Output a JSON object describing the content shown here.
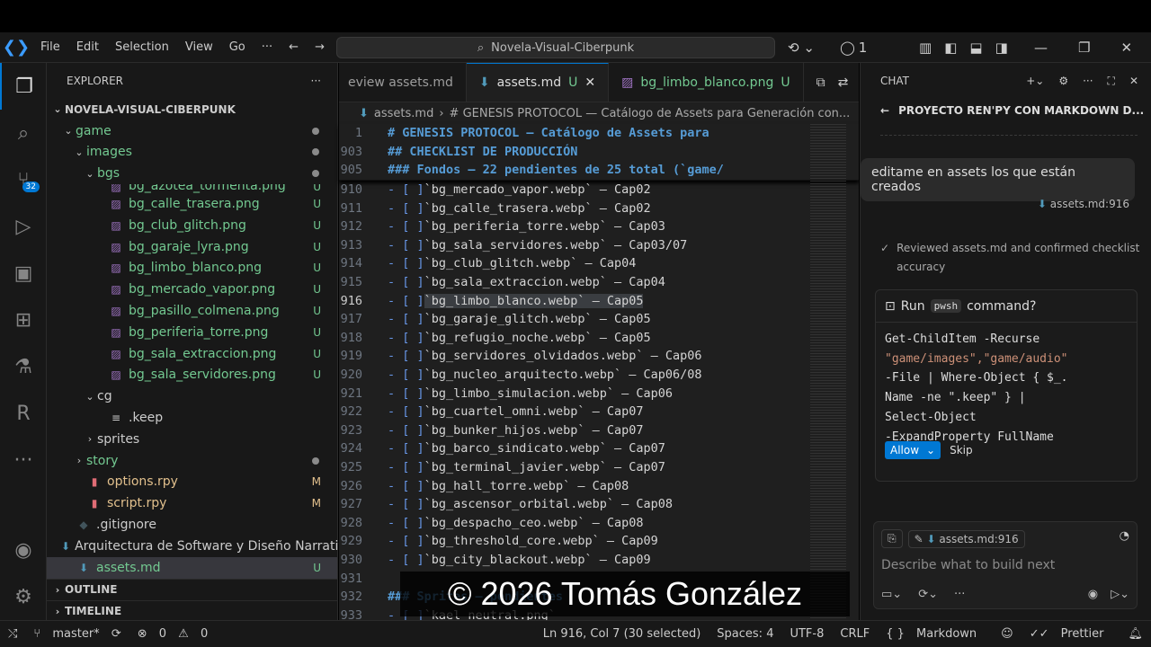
{
  "menu": [
    "File",
    "Edit",
    "Selection",
    "View",
    "Go"
  ],
  "command_center": "Novela-Visual-Ciberpunk",
  "titlebar_counter": "1",
  "source_control_badge": "32",
  "explorer": {
    "title": "EXPLORER",
    "root": "NOVELA-VISUAL-CIBERPUNK",
    "items": [
      {
        "label": "game",
        "depth": 1,
        "kind": "folder-open",
        "status": "dot"
      },
      {
        "label": "images",
        "depth": 2,
        "kind": "folder-open",
        "status": "dot"
      },
      {
        "label": "bgs",
        "depth": 3,
        "kind": "folder-open",
        "status": "dot"
      },
      {
        "label": "bg_azotea_tormenta.png",
        "depth": 4,
        "kind": "png",
        "status": "U",
        "partial": true
      },
      {
        "label": "bg_calle_trasera.png",
        "depth": 4,
        "kind": "png",
        "status": "U"
      },
      {
        "label": "bg_club_glitch.png",
        "depth": 4,
        "kind": "png",
        "status": "U"
      },
      {
        "label": "bg_garaje_lyra.png",
        "depth": 4,
        "kind": "png",
        "status": "U"
      },
      {
        "label": "bg_limbo_blanco.png",
        "depth": 4,
        "kind": "png",
        "status": "U"
      },
      {
        "label": "bg_mercado_vapor.png",
        "depth": 4,
        "kind": "png",
        "status": "U"
      },
      {
        "label": "bg_pasillo_colmena.png",
        "depth": 4,
        "kind": "png",
        "status": "U"
      },
      {
        "label": "bg_periferia_torre.png",
        "depth": 4,
        "kind": "png",
        "status": "U"
      },
      {
        "label": "bg_sala_extraccion.png",
        "depth": 4,
        "kind": "png",
        "status": "U"
      },
      {
        "label": "bg_sala_servidores.png",
        "depth": 4,
        "kind": "png",
        "status": "U"
      },
      {
        "label": "cg",
        "depth": 3,
        "kind": "folder-open",
        "status": ""
      },
      {
        "label": ".keep",
        "depth": 4,
        "kind": "file",
        "status": ""
      },
      {
        "label": "sprites",
        "depth": 3,
        "kind": "folder",
        "status": ""
      },
      {
        "label": "story",
        "depth": 2,
        "kind": "folder",
        "status": "dot"
      },
      {
        "label": "options.rpy",
        "depth": 2,
        "kind": "rpy",
        "status": "M"
      },
      {
        "label": "script.rpy",
        "depth": 2,
        "kind": "rpy",
        "status": "M"
      },
      {
        "label": ".gitignore",
        "depth": 1,
        "kind": "git",
        "status": ""
      },
      {
        "label": "Arquitectura de Software y Diseño Narrativo ...",
        "depth": 1,
        "kind": "md",
        "status": ""
      },
      {
        "label": "assets.md",
        "depth": 1,
        "kind": "md",
        "status": "U",
        "selected": true
      }
    ],
    "outline": "OUTLINE",
    "timeline": "TIMELINE"
  },
  "tabs": [
    {
      "label": "eview assets.md",
      "status": ""
    },
    {
      "label": "assets.md",
      "status": "U",
      "active": true
    },
    {
      "label": "bg_limbo_blanco.png",
      "status": "U"
    }
  ],
  "breadcrumb": {
    "file": "assets.md",
    "section": "# GENESIS PROTOCOL — Catálogo de Assets para Generación con..."
  },
  "sticky_lines": [
    {
      "n": "1",
      "text": "# GENESIS PROTOCOL — Catálogo de Assets para"
    },
    {
      "n": "903",
      "text": "## CHECKLIST DE PRODUCCIÓN"
    },
    {
      "n": "905",
      "text": "### Fondos — 22 pendientes de 25 total (`game/"
    }
  ],
  "code_lines": [
    {
      "n": "910",
      "name": "`bg_mercado_vapor.webp`",
      "cap": " — Cap02"
    },
    {
      "n": "911",
      "name": "`bg_calle_trasera.webp`",
      "cap": " — Cap02"
    },
    {
      "n": "912",
      "name": "`bg_periferia_torre.webp`",
      "cap": " — Cap03"
    },
    {
      "n": "913",
      "name": "`bg_sala_servidores.webp`",
      "cap": " — Cap03/07"
    },
    {
      "n": "914",
      "name": "`bg_club_glitch.webp`",
      "cap": " — Cap04"
    },
    {
      "n": "915",
      "name": "`bg_sala_extraccion.webp`",
      "cap": " — Cap04"
    },
    {
      "n": "916",
      "name": "`bg_limbo_blanco.webp`",
      "cap": " — Cap05",
      "current": true
    },
    {
      "n": "917",
      "name": "`bg_garaje_glitch.webp`",
      "cap": " — Cap05"
    },
    {
      "n": "918",
      "name": "`bg_refugio_noche.webp`",
      "cap": " — Cap05"
    },
    {
      "n": "919",
      "name": "`bg_servidores_olvidados.webp`",
      "cap": " — Cap06"
    },
    {
      "n": "920",
      "name": "`bg_nucleo_arquitecto.webp`",
      "cap": " — Cap06/08"
    },
    {
      "n": "921",
      "name": "`bg_limbo_simulacion.webp`",
      "cap": " — Cap06"
    },
    {
      "n": "922",
      "name": "`bg_cuartel_omni.webp`",
      "cap": " — Cap07"
    },
    {
      "n": "923",
      "name": "`bg_bunker_hijos.webp`",
      "cap": " — Cap07"
    },
    {
      "n": "924",
      "name": "`bg_barco_sindicato.webp`",
      "cap": " — Cap07"
    },
    {
      "n": "925",
      "name": "`bg_terminal_javier.webp`",
      "cap": " — Cap07"
    },
    {
      "n": "926",
      "name": "`bg_hall_torre.webp`",
      "cap": " — Cap08"
    },
    {
      "n": "927",
      "name": "`bg_ascensor_orbital.webp`",
      "cap": " — Cap08"
    },
    {
      "n": "928",
      "name": "`bg_despacho_ceo.webp`",
      "cap": " — Cap08"
    },
    {
      "n": "929",
      "name": "`bg_threshold_core.webp`",
      "cap": " — Cap09"
    },
    {
      "n": "930",
      "name": "`bg_city_blackout.webp`",
      "cap": " — Cap09"
    },
    {
      "n": "931",
      "name": "",
      "cap": ""
    },
    {
      "n": "932",
      "name": "",
      "cap": "",
      "heading": "### Sprites — pendientes"
    },
    {
      "n": "933",
      "name": "`kael_neutral.png`",
      "cap": ""
    }
  ],
  "checkbox_prefix": "- [ ] ",
  "chat": {
    "title": "CHAT",
    "session": "PROYECTO REN'PY CON MARKDOWN D...",
    "user_message": "editame en assets los que están creados",
    "user_ref": "assets.md:916",
    "reviewed": "Reviewed assets.md and confirmed checklist accuracy",
    "run_label": "Run",
    "run_shell": "pwsh",
    "run_suffix": "command?",
    "command_lines": [
      "Get-ChildItem -Recurse",
      "\"game/images\",\"game/audio\"",
      "-File | Where-Object { $_.",
      "Name -ne \".keep\" } |",
      "Select-Object",
      "-ExpandProperty FullName"
    ],
    "allow": "Allow",
    "skip": "Skip",
    "input_ref": "assets.md:916",
    "input_placeholder": "Describe what to build next"
  },
  "status": {
    "branch": "master*",
    "errors": "0",
    "warnings": "0",
    "position": "Ln 916, Col 7 (30 selected)",
    "spaces": "Spaces: 4",
    "encoding": "UTF-8",
    "eol": "CRLF",
    "language": "Markdown",
    "prettier": "Prettier"
  },
  "watermark": "© 2026 Tomás González"
}
